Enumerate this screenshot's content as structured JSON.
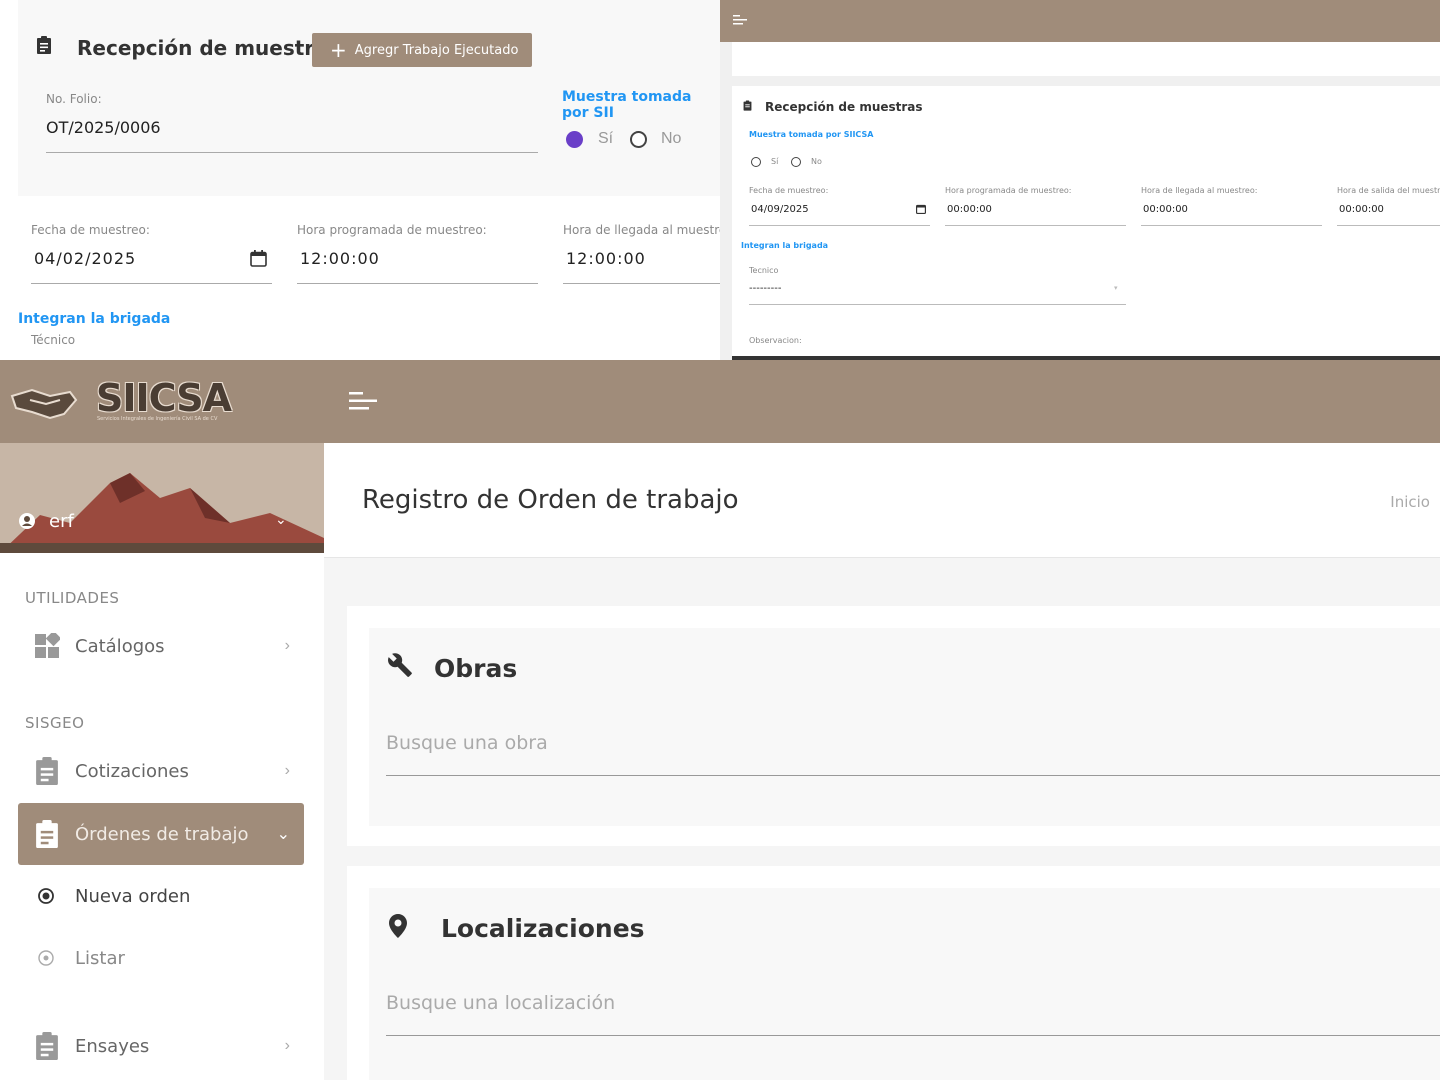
{
  "top_left": {
    "title": "Recepción de muestras",
    "add_button": "Agregr Trabajo Ejecutado",
    "folio_label": "No. Folio:",
    "folio_value": "OT/2025/0006",
    "sample_heading": "Muestra tomada por SII",
    "radio_yes": "Sí",
    "radio_no": "No",
    "date_label": "Fecha de muestreo:",
    "date_value": "04/02/2025",
    "sched_label": "Hora programada de muestreo:",
    "sched_value": "12:00:00",
    "arrival_label": "Hora de llegada al muestre",
    "arrival_value": "12:00:00",
    "brigade_heading": "Integran la brigada",
    "tech_label": "Técnico"
  },
  "top_right": {
    "title": "Recepción de muestras",
    "sample_heading": "Muestra tomada por SIICSA",
    "radio_yes": "Sí",
    "radio_no": "No",
    "date_label": "Fecha de muestreo:",
    "date_value": "04/09/2025",
    "sched_label": "Hora programada de muestreo:",
    "sched_value": "00:00:00",
    "arrival_label": "Hora de llegada al muestreo:",
    "arrival_value": "00:00:00",
    "departure_label": "Hora de salida del muestreo",
    "departure_value": "00:00:00",
    "brigade_heading": "Integran la brigada",
    "tech_label": "Tecnico",
    "tech_value": "---------",
    "obs_label": "Observacion:"
  },
  "app": {
    "logo_text": "SIICSA",
    "logo_subtext": "Servicios Integrales de Ingeniería Civil SA de CV",
    "user_name": "erf",
    "page_title": "Registro de Orden de trabajo",
    "breadcrumb": "Inicio"
  },
  "sidebar": {
    "section_utilidades": "UTILIDADES",
    "section_sisgeo": "SISGEO",
    "items": [
      {
        "label": "Catálogos"
      },
      {
        "label": "Cotizaciones"
      },
      {
        "label": "Órdenes de trabajo"
      },
      {
        "label": "Nueva orden"
      },
      {
        "label": "Listar"
      },
      {
        "label": "Ensayes"
      }
    ]
  },
  "main": {
    "obras_title": "Obras",
    "obras_placeholder": "Busque una obra",
    "loc_title": "Localizaciones",
    "loc_placeholder": "Busque una localización"
  },
  "colors": {
    "brand": "#a08c7a",
    "link_blue": "#2196f3",
    "radio_selected": "#6a3fc8"
  }
}
